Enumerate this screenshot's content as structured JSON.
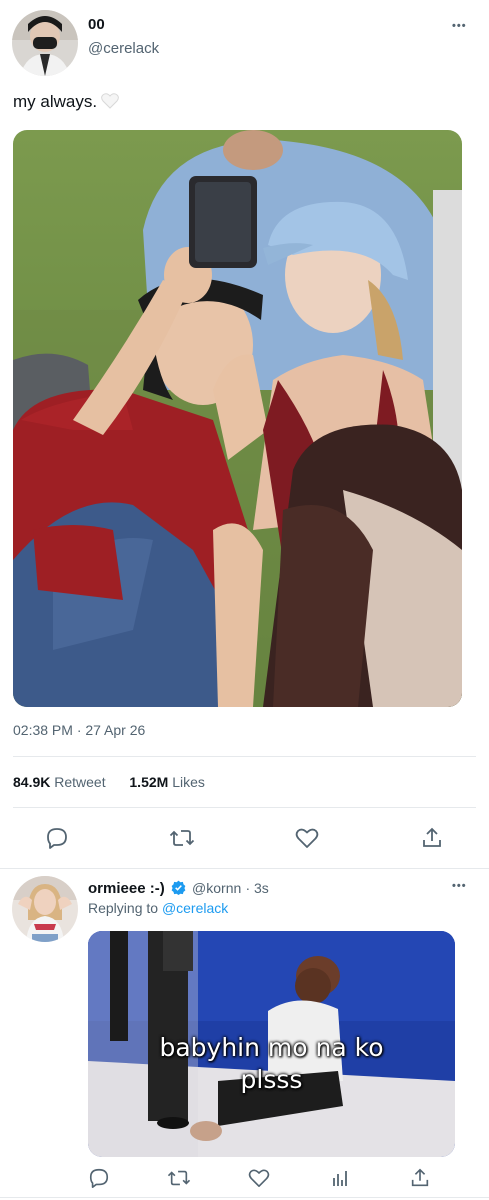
{
  "tweet": {
    "author_name": "00",
    "author_handle": "@cerelack",
    "text": "my always.",
    "timestamp": "02:38 PM · 27 Apr 26",
    "retweet_count": "84.9K",
    "retweet_label": "Retweet",
    "likes_count": "1.52M",
    "likes_label": "Likes",
    "more_label": "•••"
  },
  "reply": {
    "author_name": "ormieee :-)",
    "author_handle": "@kornn",
    "time": "· 3s",
    "replying_label": "Replying to",
    "replying_handle": "@cerelack",
    "more_label": "•••",
    "gif_caption_line1": "babyhin mo na ko",
    "gif_caption_line2": "plsss"
  },
  "icons": {
    "tweet_actions": [
      "reply-icon",
      "retweet-icon",
      "like-icon",
      "share-icon"
    ],
    "reply_actions": [
      "reply-icon",
      "retweet-icon",
      "like-icon",
      "analytics-icon",
      "share-icon"
    ]
  },
  "colors": {
    "text": "#0f1419",
    "secondary": "#536471",
    "link": "#1d9bf0",
    "divider": "#e6e9ec"
  }
}
